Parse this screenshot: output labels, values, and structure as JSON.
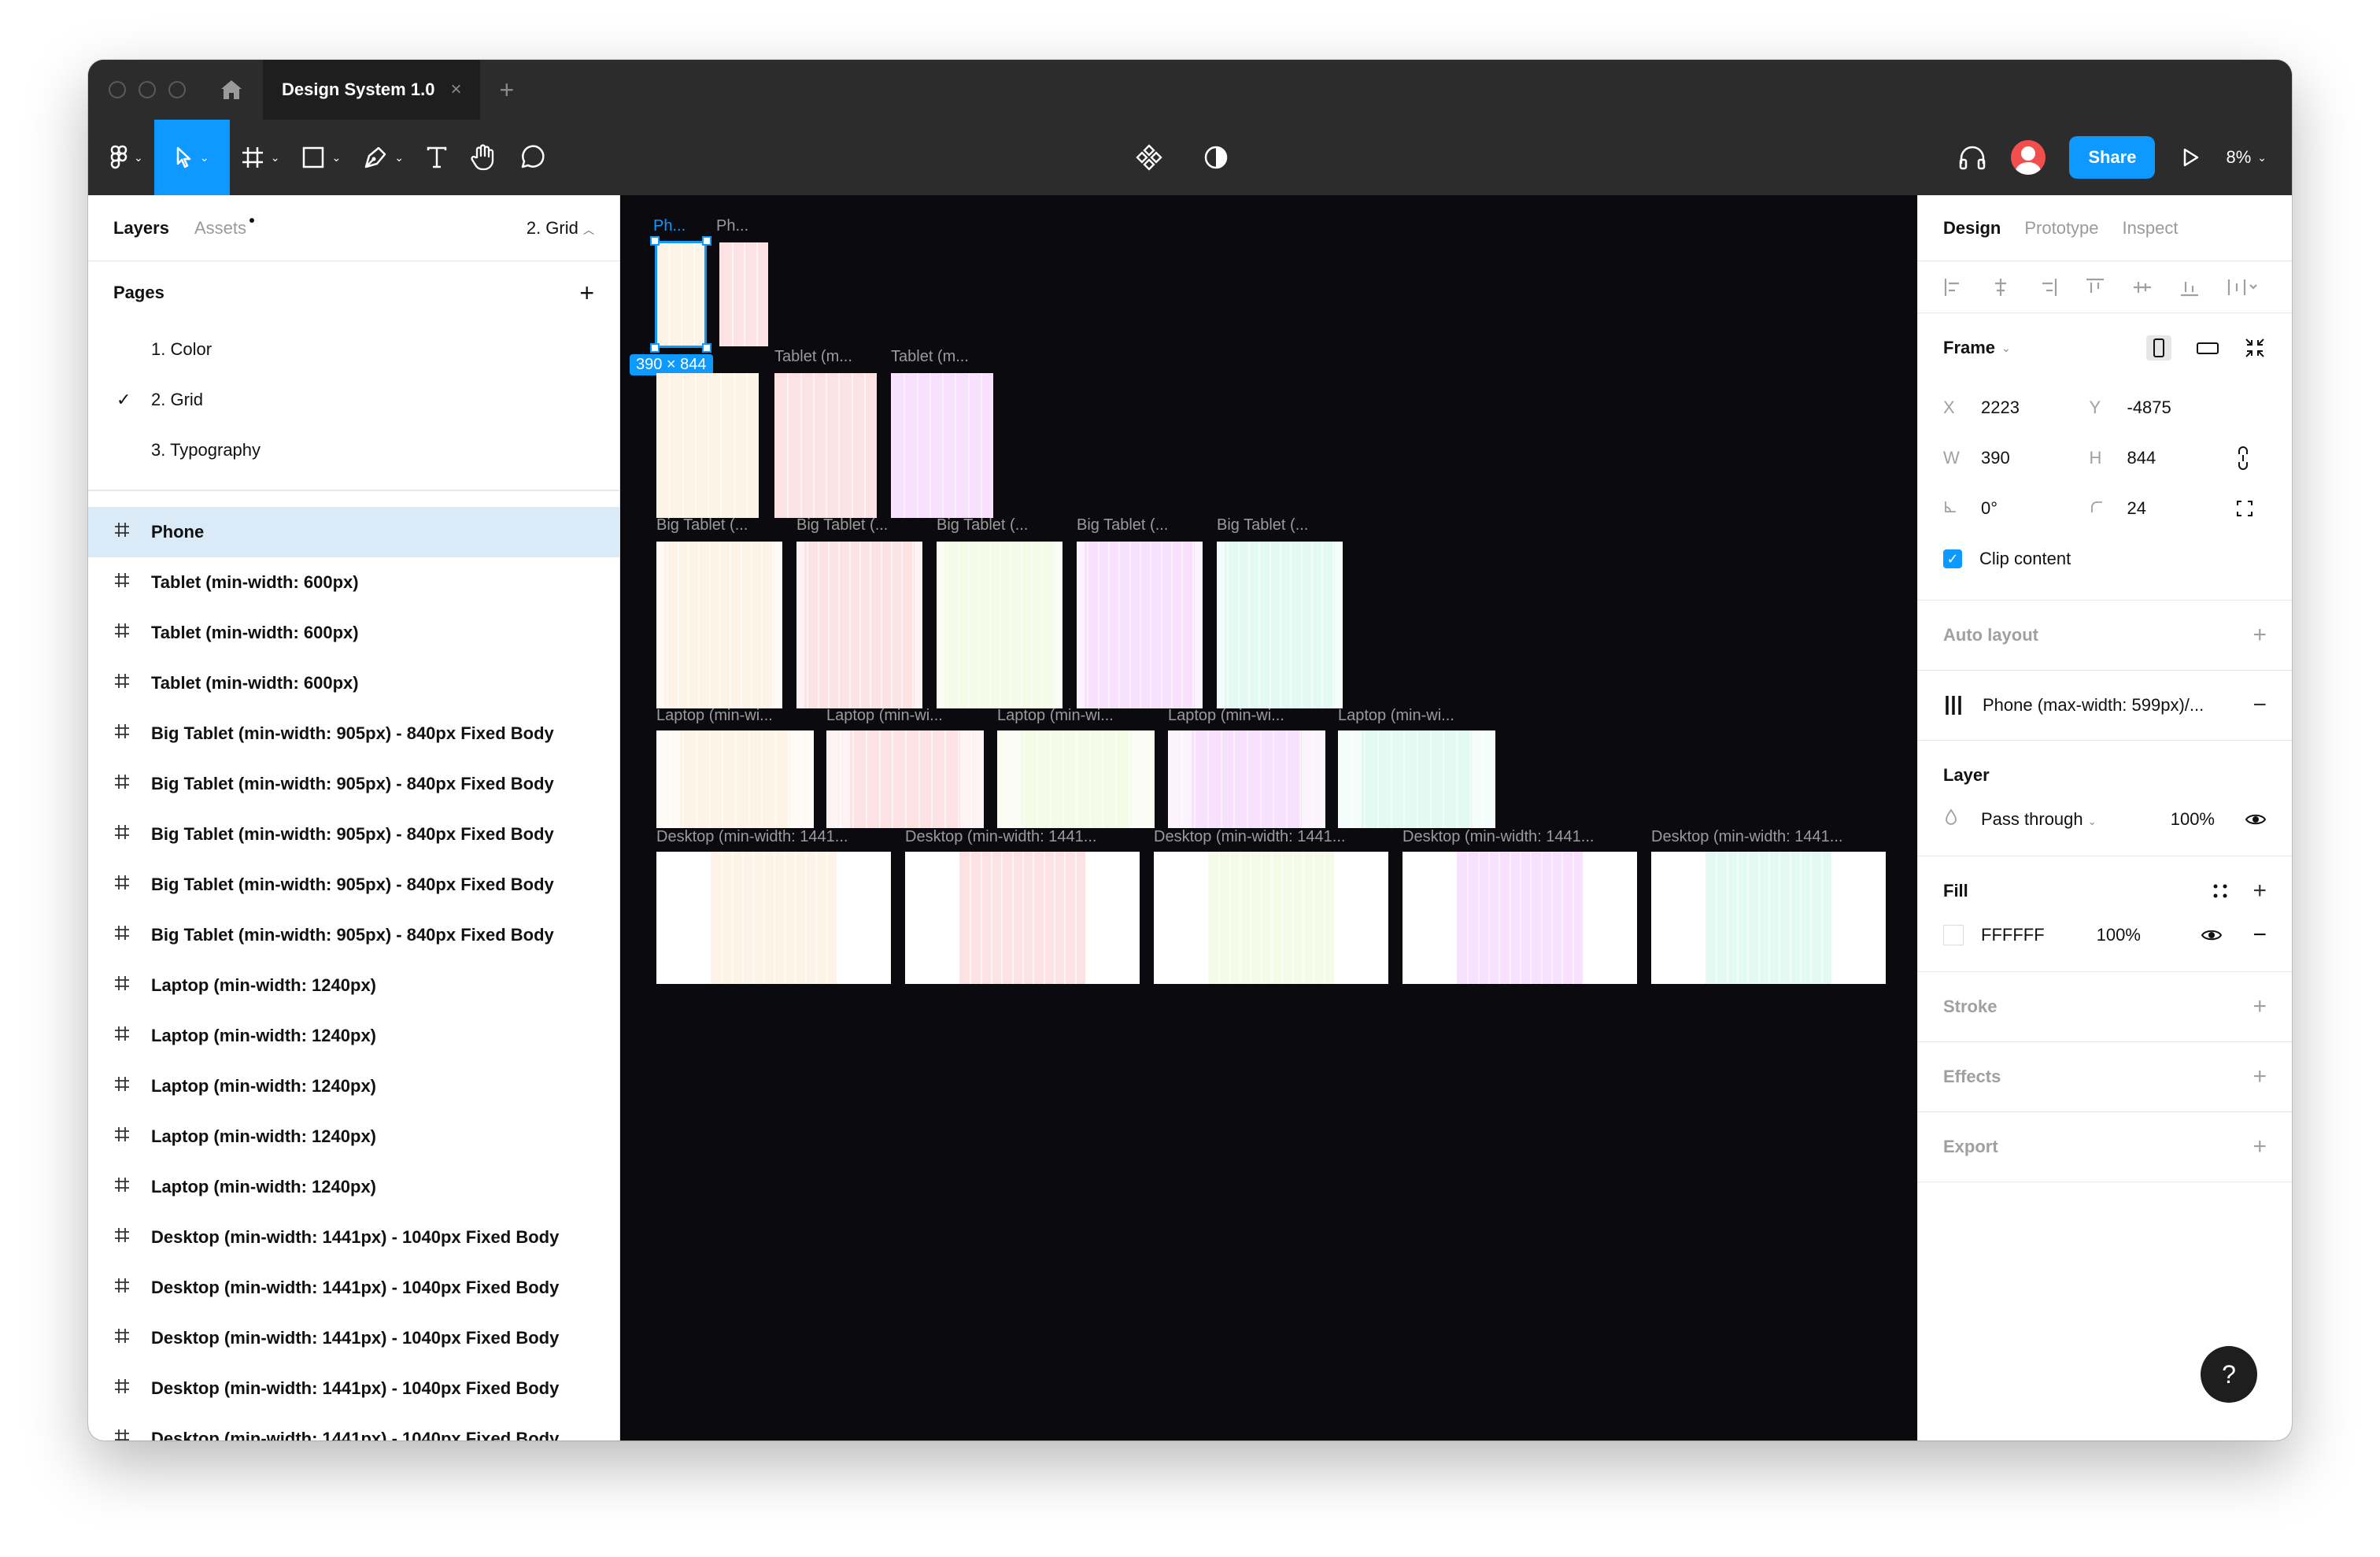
{
  "window": {
    "tab_title": "Design System 1.0",
    "tab_close": "×",
    "new_tab": "+"
  },
  "toolbar": {
    "share_label": "Share",
    "zoom": "8%"
  },
  "left_panel": {
    "layers_tab": "Layers",
    "assets_tab": "Assets",
    "current_page": "2. Grid",
    "pages_heading": "Pages",
    "add_page": "+",
    "pages": [
      {
        "label": "1. Color",
        "checked": false
      },
      {
        "label": "2. Grid",
        "checked": true
      },
      {
        "label": "3. Typography",
        "checked": false
      }
    ],
    "layers": [
      {
        "label": "Phone",
        "selected": true
      },
      {
        "label": "Tablet (min-width: 600px)",
        "selected": false
      },
      {
        "label": "Tablet (min-width: 600px)",
        "selected": false
      },
      {
        "label": "Tablet (min-width: 600px)",
        "selected": false
      },
      {
        "label": "Big Tablet (min-width: 905px) - 840px Fixed Body",
        "selected": false
      },
      {
        "label": "Big Tablet (min-width: 905px) - 840px Fixed Body",
        "selected": false
      },
      {
        "label": "Big Tablet (min-width: 905px) - 840px Fixed Body",
        "selected": false
      },
      {
        "label": "Big Tablet (min-width: 905px) - 840px Fixed Body",
        "selected": false
      },
      {
        "label": "Big Tablet (min-width: 905px) - 840px Fixed Body",
        "selected": false
      },
      {
        "label": "Laptop (min-width: 1240px)",
        "selected": false
      },
      {
        "label": "Laptop (min-width: 1240px)",
        "selected": false
      },
      {
        "label": "Laptop (min-width: 1240px)",
        "selected": false
      },
      {
        "label": "Laptop (min-width: 1240px)",
        "selected": false
      },
      {
        "label": "Laptop (min-width: 1240px)",
        "selected": false
      },
      {
        "label": "Desktop (min-width: 1441px) - 1040px Fixed Body",
        "selected": false
      },
      {
        "label": "Desktop (min-width: 1441px) - 1040px Fixed Body",
        "selected": false
      },
      {
        "label": "Desktop (min-width: 1441px) - 1040px Fixed Body",
        "selected": false
      },
      {
        "label": "Desktop (min-width: 1441px) - 1040px Fixed Body",
        "selected": false
      },
      {
        "label": "Desktop (min-width: 1441px) - 1040px Fixed Body",
        "selected": false
      }
    ]
  },
  "canvas": {
    "selection_size": "390 × 844",
    "colors": {
      "peach": "#fdf3e7",
      "pink": "#fde2e4",
      "lavender": "#f7e1fc",
      "lime": "#f4fbe6",
      "mint": "#e3faf3"
    },
    "phone_labels": [
      "Ph...",
      "Ph..."
    ],
    "tablet_labels": [
      "Tablet (m...",
      "Tablet (m...",
      "Tablet (m..."
    ],
    "big_tablet_labels": [
      "Big Tablet (...",
      "Big Tablet (...",
      "Big Tablet (...",
      "Big Tablet (...",
      "Big Tablet (..."
    ],
    "laptop_labels": [
      "Laptop (min-wi...",
      "Laptop (min-wi...",
      "Laptop (min-wi...",
      "Laptop (min-wi...",
      "Laptop (min-wi..."
    ],
    "desktop_labels": [
      "Desktop (min-width: 1441...",
      "Desktop (min-width: 1441...",
      "Desktop (min-width: 1441...",
      "Desktop (min-width: 1441...",
      "Desktop (min-width: 1441..."
    ]
  },
  "right_panel": {
    "tabs": [
      "Design",
      "Prototype",
      "Inspect"
    ],
    "frame_heading": "Frame",
    "x_label": "X",
    "x_value": "2223",
    "y_label": "Y",
    "y_value": "-4875",
    "w_label": "W",
    "w_value": "390",
    "h_label": "H",
    "h_value": "844",
    "rotation": "0°",
    "radius": "24",
    "clip_content": "Clip content",
    "auto_layout": "Auto layout",
    "layout_grid": "Phone (max-width: 599px)/...",
    "layer_heading": "Layer",
    "blend_mode": "Pass through",
    "layer_opacity": "100%",
    "fill_heading": "Fill",
    "fill_hex": "FFFFFF",
    "fill_opacity": "100%",
    "stroke_heading": "Stroke",
    "effects_heading": "Effects",
    "export_heading": "Export"
  },
  "help": "?"
}
